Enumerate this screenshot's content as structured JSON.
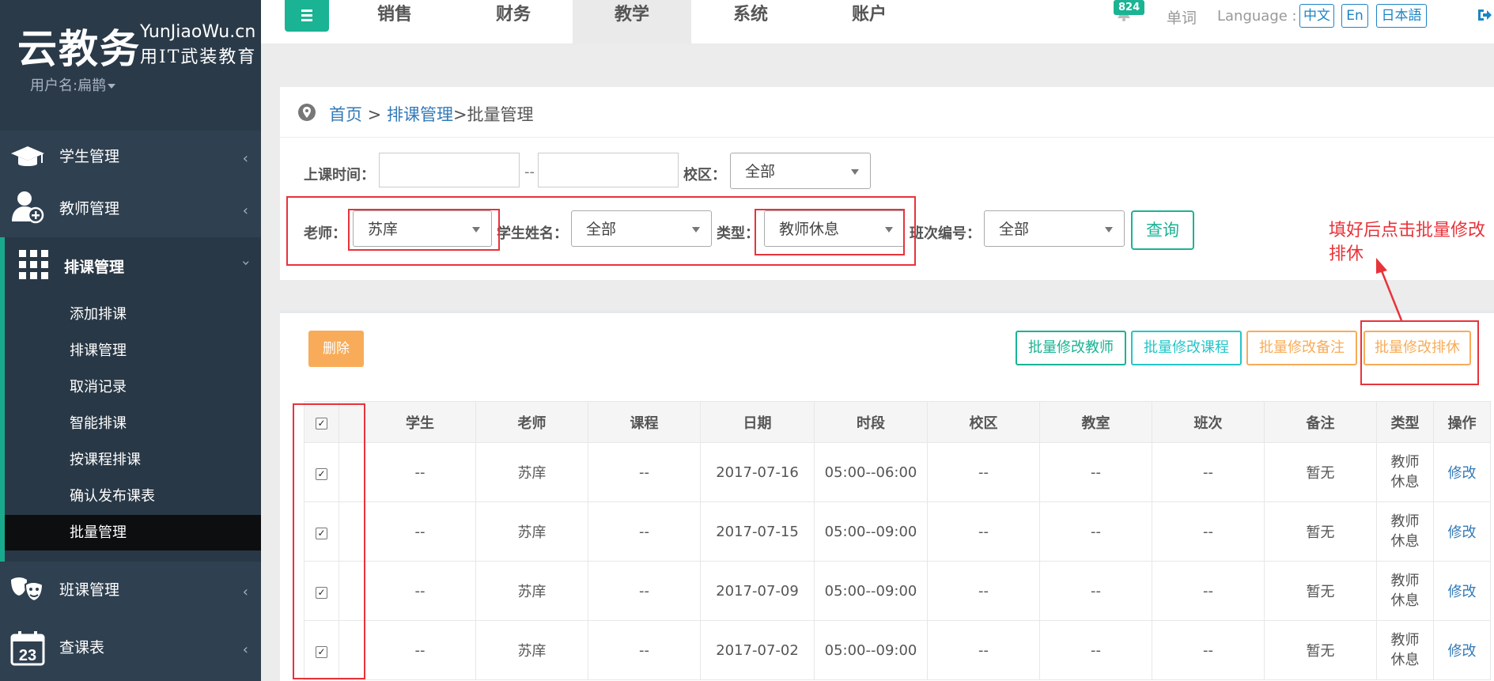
{
  "sidebar": {
    "logo_main": "云教务",
    "logo_en": "YunJiaoWu.cn",
    "logo_slogan": "用IT武装教育",
    "user_name": "用户名:扁鹊",
    "items": [
      {
        "label": "学生管理",
        "icon": "graduation-cap-icon"
      },
      {
        "label": "教师管理",
        "icon": "teacher-add-icon"
      },
      {
        "label": "排课管理",
        "icon": "grid-apps-icon"
      },
      {
        "label": "班课管理",
        "icon": "theater-masks-icon"
      },
      {
        "label": "查课表",
        "icon": "calendar-icon",
        "calendar_day": "23"
      }
    ],
    "sub_items": [
      "添加排课",
      "排课管理",
      "取消记录",
      "智能排课",
      "按课程排课",
      "确认发布课表",
      "批量管理"
    ]
  },
  "topbar": {
    "tabs": [
      "销售",
      "财务",
      "教学",
      "系统",
      "账户"
    ],
    "active_tab": "教学",
    "notification_count": "824",
    "word_link": "单词",
    "language_label": "Language :",
    "languages": [
      "中文",
      "En",
      "日本語"
    ]
  },
  "breadcrumb": {
    "home": "首页",
    "sep1": " > ",
    "section": "排课管理",
    "current": ">批量管理"
  },
  "filters": {
    "class_time_label": "上课时间：",
    "range_sep": "--",
    "campus_label": "校区：",
    "campus_value": "全部",
    "teacher_label": "老师：",
    "teacher_value": "苏庠",
    "student_label": "学生姓名：",
    "student_value": "全部",
    "type_label": "类型：",
    "type_value": "教师休息",
    "class_no_label": "班次编号：",
    "class_no_value": "全部",
    "query_button": "查询"
  },
  "actions": {
    "delete": "删除",
    "bulk_teacher": "批量修改教师",
    "bulk_course": "批量修改课程",
    "bulk_note": "批量修改备注",
    "bulk_rest": "批量修改排休"
  },
  "annotation": "填好后点击批量修改排休",
  "table": {
    "headers": [
      "学生",
      "老师",
      "课程",
      "日期",
      "时段",
      "校区",
      "教室",
      "班次",
      "备注",
      "类型",
      "操作"
    ],
    "rows": [
      {
        "student": "--",
        "teacher": "苏庠",
        "course": "--",
        "date": "2017-07-16",
        "time": "05:00--06:00",
        "campus": "--",
        "room": "--",
        "class": "--",
        "note": "暂无",
        "type": "教师休息",
        "action": "修改"
      },
      {
        "student": "--",
        "teacher": "苏庠",
        "course": "--",
        "date": "2017-07-15",
        "time": "05:00--09:00",
        "campus": "--",
        "room": "--",
        "class": "--",
        "note": "暂无",
        "type": "教师休息",
        "action": "修改"
      },
      {
        "student": "--",
        "teacher": "苏庠",
        "course": "--",
        "date": "2017-07-09",
        "time": "05:00--09:00",
        "campus": "--",
        "room": "--",
        "class": "--",
        "note": "暂无",
        "type": "教师休息",
        "action": "修改"
      },
      {
        "student": "--",
        "teacher": "苏庠",
        "course": "--",
        "date": "2017-07-02",
        "time": "05:00--09:00",
        "campus": "--",
        "room": "--",
        "class": "--",
        "note": "暂无",
        "type": "教师休息",
        "action": "修改"
      }
    ]
  },
  "colors": {
    "sidebar": "#2f4050",
    "accent": "#1ab394",
    "warning": "#f8ac59",
    "annotation": "#e8333a",
    "link": "#337ab7"
  }
}
